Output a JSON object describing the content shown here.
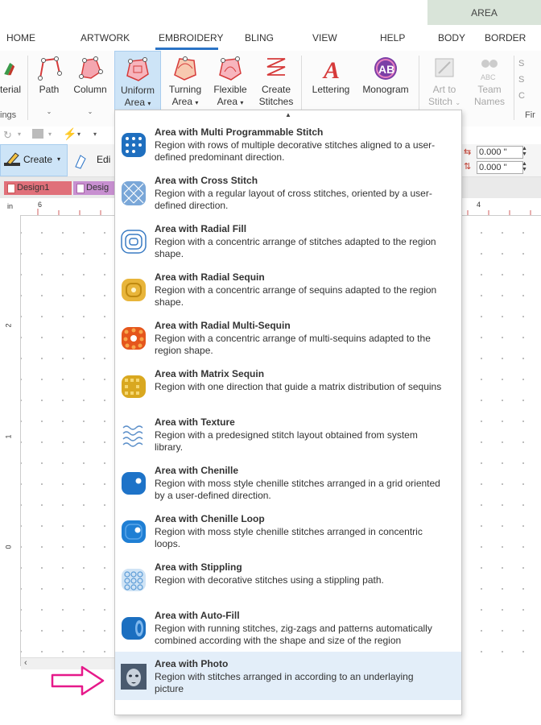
{
  "context_tab": "AREA",
  "tabs": [
    "HOME",
    "ARTWORK",
    "EMBROIDERY",
    "BLING",
    "VIEW",
    "HELP",
    "BODY",
    "BORDER"
  ],
  "ribbon": {
    "left_partial": "terial",
    "left_group_partial": "ings",
    "buttons": [
      {
        "line1": "Path",
        "line2": ""
      },
      {
        "line1": "Column",
        "line2": ""
      },
      {
        "line1": "Uniform",
        "line2": "Area"
      },
      {
        "line1": "Turning",
        "line2": "Area"
      },
      {
        "line1": "Flexible",
        "line2": "Area"
      },
      {
        "line1": "Create",
        "line2": "Stitches"
      },
      {
        "line1": "Lettering",
        "line2": ""
      },
      {
        "line1": "Monogram",
        "line2": ""
      },
      {
        "line1": "Art to",
        "line2": "Stitch"
      },
      {
        "line1": "Team",
        "line2": "Names"
      }
    ],
    "right_partial": "Fir",
    "right_items": [
      "S",
      "S",
      "C"
    ]
  },
  "toolbar": {
    "create_label": "Create",
    "edit_label": "Edi"
  },
  "doc_tabs": [
    "Design1",
    "Desig"
  ],
  "ruler": {
    "unit": "in",
    "top_labels": [
      "6",
      "4"
    ],
    "left_labels": [
      "2",
      "1",
      "0"
    ]
  },
  "properties": {
    "width_value": "0.000 \"",
    "height_value": "0.000 \""
  },
  "menu_items": [
    {
      "title": "Area with Multi Programmable Stitch",
      "desc": "Region with rows of multiple decorative stitches aligned to a user-defined predominant direction."
    },
    {
      "title": "Area with Cross Stitch",
      "desc": "Region with a regular layout of cross stitches, oriented by a user-defined direction."
    },
    {
      "title": "Area with Radial Fill",
      "desc": "Region with a concentric arrange of stitches adapted to the region shape."
    },
    {
      "title": "Area with Radial Sequin",
      "desc": "Region with a concentric arrange of sequins adapted to the region shape."
    },
    {
      "title": "Area with Radial Multi-Sequin",
      "desc": "Region with a concentric arrange of multi-sequins adapted to the region shape."
    },
    {
      "title": "Area with Matrix Sequin",
      "desc": "Region with one direction that guide a matrix distribution of sequins"
    },
    {
      "title": "Area with Texture",
      "desc": "Region with a predesigned stitch layout obtained from system library."
    },
    {
      "title": "Area with Chenille",
      "desc": "Region with moss style chenille stitches arranged in a grid oriented by a user-defined direction."
    },
    {
      "title": "Area with Chenille Loop",
      "desc": "Region with moss style chenille stitches arranged in concentric loops."
    },
    {
      "title": "Area with Stippling",
      "desc": "Region with decorative stitches using a stippling path."
    },
    {
      "title": "Area with Auto-Fill",
      "desc": "Region with running stitches, zig-zags and patterns automatically combined according with the shape and size of the region"
    },
    {
      "title": "Area with Photo",
      "desc": "Region with stitches arranged in according to an underlaying picture"
    }
  ],
  "colors": {
    "accent": "#2a73c6",
    "selected_bg": "#cde4f7",
    "arrow": "#e6198a",
    "doc_tab1": "#e0707a",
    "doc_tab2": "#c78fd0"
  }
}
